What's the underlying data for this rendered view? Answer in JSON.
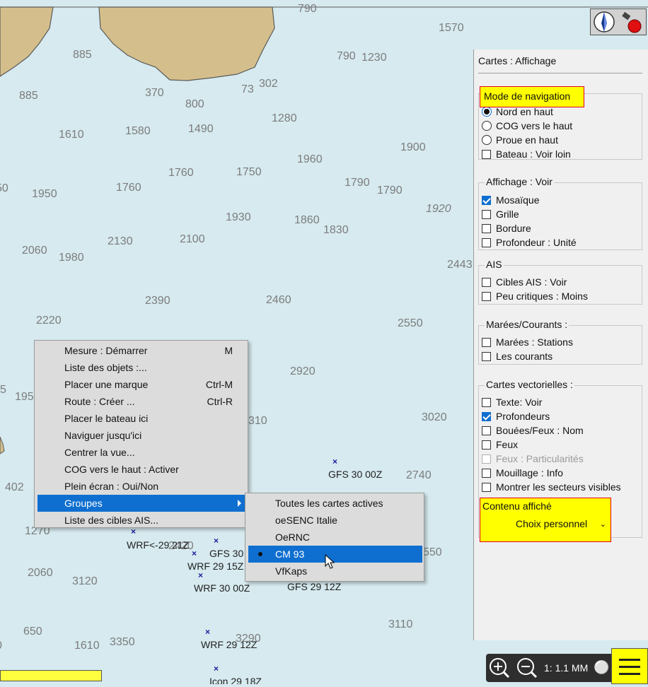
{
  "chart": {
    "depths": [
      "790",
      "1570",
      "885",
      "790",
      "1230",
      "370",
      "73",
      "302",
      "885",
      "800",
      "1280",
      "1610",
      "1580",
      "1490",
      "1960",
      "1900",
      "1760",
      "1750",
      "1790",
      "1790",
      "50",
      "1950",
      "1760",
      "1920",
      "1930",
      "1860",
      "1830",
      "2060",
      "1980",
      "2130",
      "2100",
      "2443",
      "2390",
      "2460",
      "2220",
      "2550",
      "2920",
      "5",
      "195",
      "3020",
      "310",
      "2740",
      "402",
      "1270",
      "2420",
      "550",
      "2060",
      "3120",
      "3110",
      "650",
      "1610",
      "3350",
      "3290",
      "0"
    ],
    "waypoints": [
      "GFS 30 00Z",
      "WRF<-29 21Z",
      "GFS 30",
      "WRF 29 15Z",
      "WRF 30 00Z",
      "GFS 29 12Z",
      "WRF 29 12Z",
      "Icon 29 18Z"
    ]
  },
  "panel": {
    "title": "Cartes : Affichage",
    "nav_mode": {
      "label": "Mode de navigation",
      "options": [
        {
          "label": "Nord en haut",
          "checked": true
        },
        {
          "label": "COG vers le haut",
          "checked": false
        },
        {
          "label": "Proue en haut",
          "checked": false
        }
      ],
      "look_far": {
        "label": "Bateau : Voir loin",
        "checked": false
      }
    },
    "display": {
      "label": "Affichage : Voir",
      "items": [
        {
          "label": "Mosaïque",
          "checked": true
        },
        {
          "label": "Grille",
          "checked": false
        },
        {
          "label": "Bordure",
          "checked": false
        },
        {
          "label": "Profondeur : Unité",
          "checked": false
        }
      ]
    },
    "ais": {
      "label": "AIS",
      "items": [
        {
          "label": "Cibles AIS : Voir",
          "checked": false
        },
        {
          "label": "Peu critiques : Moins",
          "checked": false
        }
      ]
    },
    "tides": {
      "label": "Marées/Courants :",
      "items": [
        {
          "label": "Marées : Stations",
          "checked": false
        },
        {
          "label": "Les courants",
          "checked": false
        }
      ]
    },
    "vector": {
      "label": "Cartes vectorielles :",
      "items": [
        {
          "label": "Texte: Voir",
          "checked": false,
          "disabled": false
        },
        {
          "label": "Profondeurs",
          "checked": true,
          "disabled": false
        },
        {
          "label": "Bouées/Feux : Nom",
          "checked": false,
          "disabled": false
        },
        {
          "label": "Feux",
          "checked": false,
          "disabled": false
        },
        {
          "label": "Feux : Particularités",
          "checked": false,
          "disabled": true
        },
        {
          "label": "Mouillage : Info",
          "checked": false,
          "disabled": false
        },
        {
          "label": "Montrer les secteurs visibles",
          "checked": false,
          "disabled": false
        }
      ]
    },
    "content": {
      "label": "Contenu affiché",
      "value": "Choix personnel"
    }
  },
  "context_menu": {
    "items": [
      {
        "label": "Mesure : Démarrer",
        "shortcut": "M"
      },
      {
        "label": "Liste des objets :...",
        "shortcut": ""
      },
      {
        "label": "Placer une marque",
        "shortcut": "Ctrl-M"
      },
      {
        "label": "Route : Créer ...",
        "shortcut": "Ctrl-R"
      },
      {
        "label": "Placer le bateau ici",
        "shortcut": ""
      },
      {
        "label": "Naviguer jusqu'ici",
        "shortcut": ""
      },
      {
        "label": "Centrer la vue...",
        "shortcut": ""
      },
      {
        "label": "COG vers le haut : Activer",
        "shortcut": ""
      },
      {
        "label": "Plein écran : Oui/Non",
        "shortcut": ""
      },
      {
        "label": "Groupes",
        "shortcut": "",
        "submenu": true
      },
      {
        "label": "Liste des cibles AIS...",
        "shortcut": ""
      }
    ],
    "active_index": 9
  },
  "submenu": {
    "items": [
      {
        "label": "Toutes les cartes actives",
        "selected": false
      },
      {
        "label": "oeSENC Italie",
        "selected": false
      },
      {
        "label": "OeRNC",
        "selected": false
      },
      {
        "label": "CM 93",
        "selected": true
      },
      {
        "label": "VfKaps",
        "selected": false
      }
    ],
    "active_index": 3
  },
  "toolbar": {
    "scale": "1: 1.1 MM"
  },
  "colors": {
    "sea": "#d6eaef",
    "land": "#d4bf8c",
    "highlight": "#ffff00",
    "highlight_border": "#e0001a",
    "menu_active": "#0f6fd0"
  }
}
